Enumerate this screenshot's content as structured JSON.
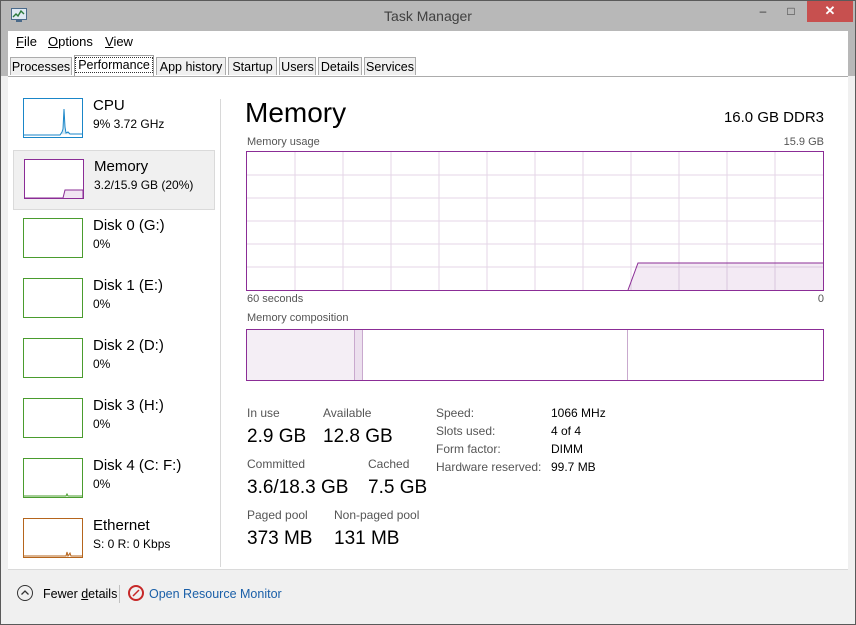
{
  "window": {
    "title": "Task Manager",
    "controls": {
      "minimize": "–",
      "maximize": "□",
      "close": "✕"
    }
  },
  "menu": [
    {
      "accel": "F",
      "rest": "ile"
    },
    {
      "accel": "O",
      "rest": "ptions"
    },
    {
      "accel": "V",
      "rest": "iew"
    }
  ],
  "tabs": [
    "Processes",
    "Performance",
    "App history",
    "Startup",
    "Users",
    "Details",
    "Services"
  ],
  "active_tab": "Performance",
  "sidebar": [
    {
      "name": "CPU",
      "sub": "9%  3.72 GHz"
    },
    {
      "name": "Memory",
      "sub": "3.2/15.9 GB (20%)"
    },
    {
      "name": "Disk 0 (G:)",
      "sub": "0%"
    },
    {
      "name": "Disk 1 (E:)",
      "sub": "0%"
    },
    {
      "name": "Disk 2 (D:)",
      "sub": "0%"
    },
    {
      "name": "Disk 3 (H:)",
      "sub": "0%"
    },
    {
      "name": "Disk 4 (C: F:)",
      "sub": "0%"
    },
    {
      "name": "Ethernet",
      "sub": "S: 0  R: 0 Kbps"
    }
  ],
  "memory": {
    "heading": "Memory",
    "spec": "16.0 GB DDR3",
    "usage_label": "Memory usage",
    "usage_max": "15.9 GB",
    "x_left": "60 seconds",
    "x_right": "0",
    "composition_label": "Memory composition",
    "stats": {
      "in_use_label": "In use",
      "in_use": "2.9 GB",
      "available_label": "Available",
      "available": "12.8 GB",
      "committed_label": "Committed",
      "committed": "3.6/18.3 GB",
      "cached_label": "Cached",
      "cached": "7.5 GB",
      "paged_label": "Paged pool",
      "paged": "373 MB",
      "nonpaged_label": "Non-paged pool",
      "nonpaged": "131 MB"
    },
    "details": [
      {
        "label": "Speed:",
        "value": "1066 MHz"
      },
      {
        "label": "Slots used:",
        "value": "4 of 4"
      },
      {
        "label": "Form factor:",
        "value": "DIMM"
      },
      {
        "label": "Hardware reserved:",
        "value": "99.7 MB"
      }
    ]
  },
  "footer": {
    "fewer_details": "Fewer details",
    "fewer_accel_index": 6,
    "resource_monitor": "Open Resource Monitor"
  },
  "colors": {
    "memory": "#8b2d96",
    "cpu": "#1a86c8",
    "disk": "#4a9c2e",
    "ethernet": "#b5651d"
  }
}
